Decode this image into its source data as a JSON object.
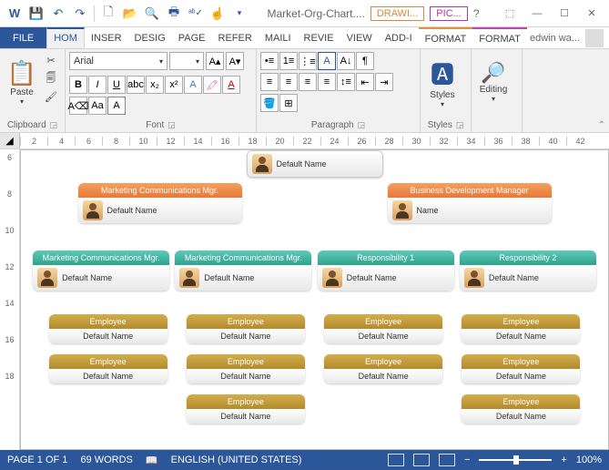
{
  "title": "Market-Org-Chart....",
  "toolTabs": {
    "drawing": "DRAWI...",
    "picture": "PIC..."
  },
  "tabs": {
    "file": "FILE",
    "home": "HOM",
    "insert": "INSER",
    "design": "DESIG",
    "page": "PAGE",
    "refer": "REFER",
    "mail": "MAILI",
    "review": "REVIE",
    "view": "VIEW",
    "addin": "ADD-I",
    "format1": "FORMAT",
    "format2": "FORMAT"
  },
  "user": "edwin wa...",
  "ribbon": {
    "paste": "Paste",
    "clipboard": "Clipboard",
    "font": "Font",
    "fontName": "Arial",
    "fontSize": "",
    "paragraph": "Paragraph",
    "styles": "Styles",
    "editing": "Editing"
  },
  "ruler": [
    "2",
    "4",
    "6",
    "8",
    "10",
    "12",
    "14",
    "16",
    "18",
    "20",
    "22",
    "24",
    "26",
    "28",
    "30",
    "32",
    "34",
    "36",
    "38",
    "40",
    "42"
  ],
  "vruler": [
    "6",
    "8",
    "10",
    "12",
    "14",
    "16",
    "18"
  ],
  "org": {
    "top": {
      "title": "",
      "name": "Default Name"
    },
    "l2a": {
      "title": "Marketing Communications Mgr.",
      "name": "Default Name"
    },
    "l2b": {
      "title": "Business Development Manager",
      "name": "Name"
    },
    "l3a": {
      "title": "Marketing Communications Mgr.",
      "name": "Default Name"
    },
    "l3b": {
      "title": "Marketing Communications Mgr.",
      "name": "Default Name"
    },
    "l3c": {
      "title": "Responsibility 1",
      "name": "Default Name"
    },
    "l3d": {
      "title": "Responsibility 2",
      "name": "Default Name"
    },
    "emp": {
      "title": "Employee",
      "name": "Default Name"
    }
  },
  "status": {
    "page": "PAGE 1 OF 1",
    "words": "69 WORDS",
    "lang": "ENGLISH (UNITED STATES)",
    "zoom": "100%"
  }
}
